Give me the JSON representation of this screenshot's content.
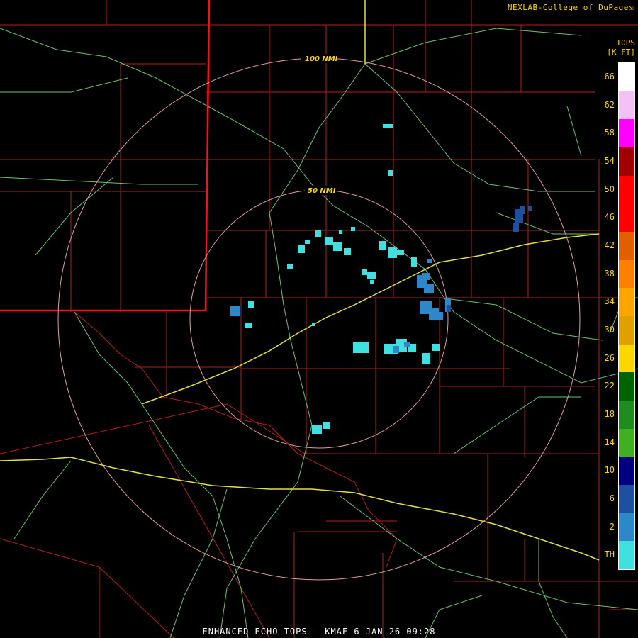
{
  "credit": "NEXLAB-College of DuPage",
  "credit_icon": "corner-arrow-icon",
  "legend": {
    "title_line1": "TOPS",
    "title_line2": "[K FT]",
    "labels": [
      "66",
      "62",
      "58",
      "54",
      "50",
      "46",
      "42",
      "38",
      "34",
      "30",
      "26",
      "22",
      "18",
      "14",
      "10",
      "6",
      "2",
      "TH"
    ],
    "colors": [
      "#ffffff",
      "#f5c0f5",
      "#ff00ff",
      "#a00000",
      "#ff0000",
      "#ff0000",
      "#e06000",
      "#ff8000",
      "#ffa500",
      "#e0a000",
      "#ffd700",
      "#006400",
      "#1e8c1e",
      "#40b020",
      "#000080",
      "#1e50a0",
      "#2c88c8",
      "#40e0e0"
    ]
  },
  "rings": {
    "outer_label": "100 NMI",
    "inner_label": "50 NMI"
  },
  "colors": {
    "county_lines": "#b02020",
    "state_line": "#ff1010",
    "highways": "#70c070",
    "interstate": "#e0e040",
    "range_rings": "#e0a0a0"
  },
  "footer": "ENHANCED ECHO TOPS - KMAF 6 JAN 26 09:28"
}
